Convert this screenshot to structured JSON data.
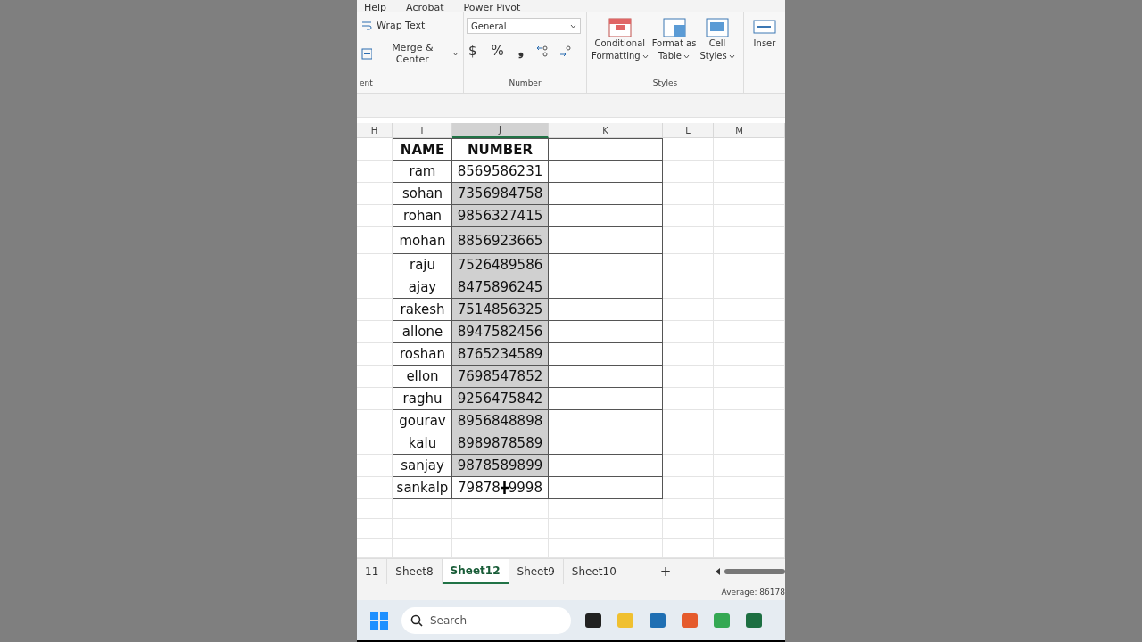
{
  "menu": [
    "Help",
    "Acrobat",
    "Power Pivot"
  ],
  "ribbon": {
    "alignment": {
      "label": "ent",
      "wrap": "Wrap Text",
      "merge": "Merge & Center"
    },
    "number": {
      "label": "Number",
      "format": "General",
      "currency": "$",
      "percent": "%",
      "comma": "❟"
    },
    "styles": {
      "label": "Styles",
      "buttons": [
        {
          "line1": "Conditional",
          "line2": "Formatting",
          "kind": "conditional"
        },
        {
          "line1": "Format as",
          "line2": "Table",
          "kind": "table"
        },
        {
          "line1": "Cell",
          "line2": "Styles",
          "kind": "cell"
        }
      ]
    },
    "insert": "Inser"
  },
  "columns": [
    {
      "label": "H",
      "selected": false
    },
    {
      "label": "I",
      "selected": false
    },
    {
      "label": "J",
      "selected": true
    },
    {
      "label": "K",
      "selected": false
    },
    {
      "label": "L",
      "selected": false
    },
    {
      "label": "M",
      "selected": false
    }
  ],
  "table": {
    "header": [
      "NAME",
      "NUMBER"
    ],
    "rows": [
      {
        "name": "ram",
        "number": "8569586231",
        "selected": false
      },
      {
        "name": "sohan",
        "number": "7356984758",
        "selected": true
      },
      {
        "name": "rohan",
        "number": "9856327415",
        "selected": true
      },
      {
        "name": "mohan",
        "number": "8856923665",
        "selected": true
      },
      {
        "name": "raju",
        "number": "7526489586",
        "selected": true
      },
      {
        "name": "ajay",
        "number": "8475896245",
        "selected": true
      },
      {
        "name": "rakesh",
        "number": "7514856325",
        "selected": true
      },
      {
        "name": "allone",
        "number": "8947582456",
        "selected": true
      },
      {
        "name": "roshan",
        "number": "8765234589",
        "selected": true
      },
      {
        "name": "ellon",
        "number": "7698547852",
        "selected": true
      },
      {
        "name": "raghu",
        "number": "9256475842",
        "selected": true
      },
      {
        "name": "gourav",
        "number": "8956848898",
        "selected": true
      },
      {
        "name": "kalu",
        "number": "8989878589",
        "selected": true
      },
      {
        "name": "sanjay",
        "number": "9878589899",
        "selected": true
      },
      {
        "name": "sankalp",
        "number": "79878",
        "number_rest": "9998",
        "selected": false
      }
    ]
  },
  "sheets": [
    {
      "label": "11",
      "selected": false
    },
    {
      "label": "Sheet8",
      "selected": false
    },
    {
      "label": "Sheet12",
      "selected": true
    },
    {
      "label": "Sheet9",
      "selected": false
    },
    {
      "label": "Sheet10",
      "selected": false
    }
  ],
  "add_sheet": "+",
  "status": "Average: 86178",
  "taskbar": {
    "search_placeholder": "Search"
  }
}
